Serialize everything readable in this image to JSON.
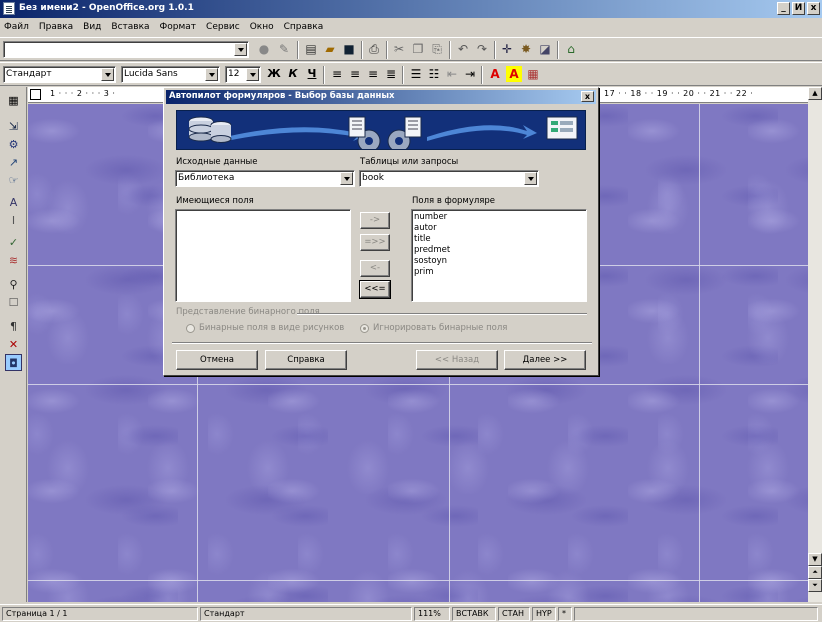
{
  "window": {
    "title": "Без имени2 - OpenOffice.org 1.0.1",
    "controls": [
      "_",
      "И",
      "x"
    ]
  },
  "menu": [
    "Файл",
    "Правка",
    "Вид",
    "Вставка",
    "Формат",
    "Сервис",
    "Окно",
    "Справка"
  ],
  "toolbar_top": {
    "url_value": ""
  },
  "toolbar_format": {
    "style": "Стандарт",
    "font": "Lucida Sans",
    "size": "12",
    "bold": "Ж",
    "italic": "К",
    "underline": "Ч"
  },
  "ruler": {
    "left_numbers": "1 · · · 2 · · · 3 ·",
    "right_numbers": "17 · · 18 · · 19 · · 20 · · 21 · · 22 ·"
  },
  "dialog": {
    "title": "Автопилот формуляров - Выбор базы данных",
    "close": "x",
    "source_label": "Исходные данные",
    "source_value": "Библиотека",
    "tables_label": "Таблицы или запросы",
    "tables_value": "book",
    "available_label": "Имеющиеся поля",
    "available_fields": [],
    "form_fields_label": "Поля в формуляре",
    "form_fields": [
      "number",
      "autor",
      "title",
      "predmet",
      "sostoyn",
      "prim"
    ],
    "move_buttons": [
      "->",
      "=>>",
      "<-",
      "<<="
    ],
    "binary_group_label": "Представление бинарного поля",
    "binary_option_1": "Бинарные поля в виде рисунков",
    "binary_option_2": "Игнорировать бинарные поля",
    "btn_cancel": "Отмена",
    "btn_help": "Справка",
    "btn_back": "<< Назад",
    "btn_next": "Далее >>"
  },
  "statusbar": {
    "page": "Страница 1 / 1",
    "style": "Стандарт",
    "zoom": "111%",
    "insert": "ВСТАВК",
    "std": "СТАН",
    "hyp": "HYP",
    "star": "*"
  },
  "colors": {
    "titlebar_start": "#0a246a",
    "titlebar_end": "#a6caf0",
    "document_bg": "#7f78c2",
    "banner_bg": "#12307a"
  }
}
